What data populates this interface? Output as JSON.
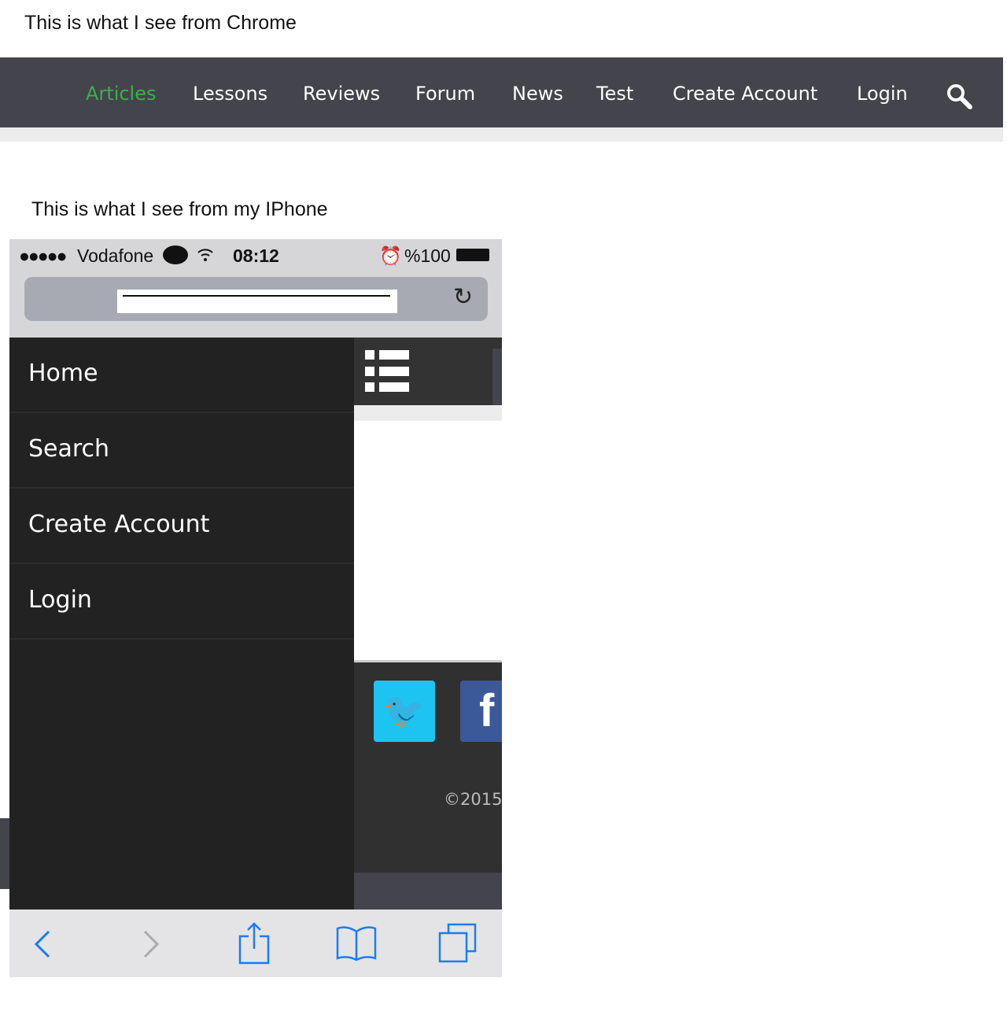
{
  "captions": {
    "chrome": "This is what I see from Chrome",
    "iphone": "This is what I see from my IPhone"
  },
  "desktop_nav": {
    "items": [
      "Articles",
      "Lessons",
      "Reviews",
      "Forum",
      "News",
      "Test",
      "Create Account",
      "Login"
    ],
    "active_color": "#3fae49",
    "icon": "search-icon"
  },
  "status_bar": {
    "carrier": "Vodafone",
    "time": "08:12",
    "battery": "%100"
  },
  "menu": {
    "items": [
      "Home",
      "Search",
      "Create Account",
      "Login"
    ]
  },
  "footer": {
    "copyright": "©2015"
  },
  "colors": {
    "twitter": "#1dc4f2",
    "facebook": "#3b5998",
    "ios_blue": "#1a7cf5"
  }
}
